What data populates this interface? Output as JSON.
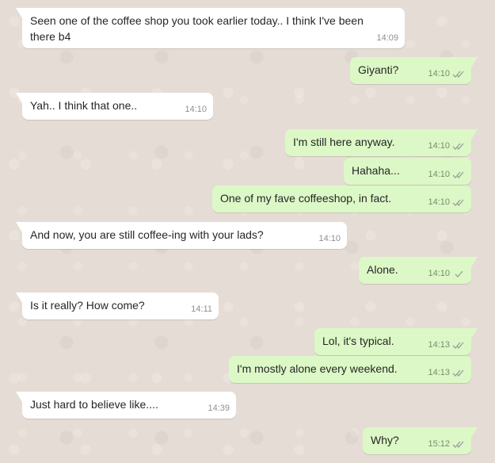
{
  "colors": {
    "wallpaper": "#e5ddd5",
    "incoming_bubble": "#ffffff",
    "outgoing_bubble": "#dcf8c6",
    "tick_grey": "#9aa09a",
    "tick_blue": "#4fc3f7"
  },
  "messages": [
    {
      "dir": "in",
      "text": "Seen one of the coffee shop you took earlier today.. I think I've been\nthere b4",
      "time": "14:09",
      "status": ""
    },
    {
      "dir": "out",
      "text": "Giyanti?",
      "time": "14:10",
      "status": "double-check-icon"
    },
    {
      "dir": "in",
      "text": "Yah.. I think that one..",
      "time": "14:10",
      "status": ""
    },
    {
      "dir": "out",
      "text": "I'm still here anyway.",
      "time": "14:10",
      "status": "double-check-icon"
    },
    {
      "dir": "out",
      "text": "Hahaha...",
      "time": "14:10",
      "status": "double-check-icon"
    },
    {
      "dir": "out",
      "text": "One of my fave coffeeshop, in fact.",
      "time": "14:10",
      "status": "double-check-icon"
    },
    {
      "dir": "in",
      "text": "And now, you are still coffee-ing with your lads?",
      "time": "14:10",
      "status": ""
    },
    {
      "dir": "out",
      "text": "Alone.",
      "time": "14:10",
      "status": "single-check-icon"
    },
    {
      "dir": "in",
      "text": "Is it really? How come?",
      "time": "14:11",
      "status": ""
    },
    {
      "dir": "out",
      "text": "Lol, it's typical.",
      "time": "14:13",
      "status": "double-check-icon"
    },
    {
      "dir": "out",
      "text": "I'm mostly alone every weekend.",
      "time": "14:13",
      "status": "double-check-icon"
    },
    {
      "dir": "in",
      "text": "Just hard to believe like....",
      "time": "14:39",
      "status": ""
    },
    {
      "dir": "out",
      "text": "Why?",
      "time": "15:12",
      "status": "double-check-icon"
    }
  ]
}
